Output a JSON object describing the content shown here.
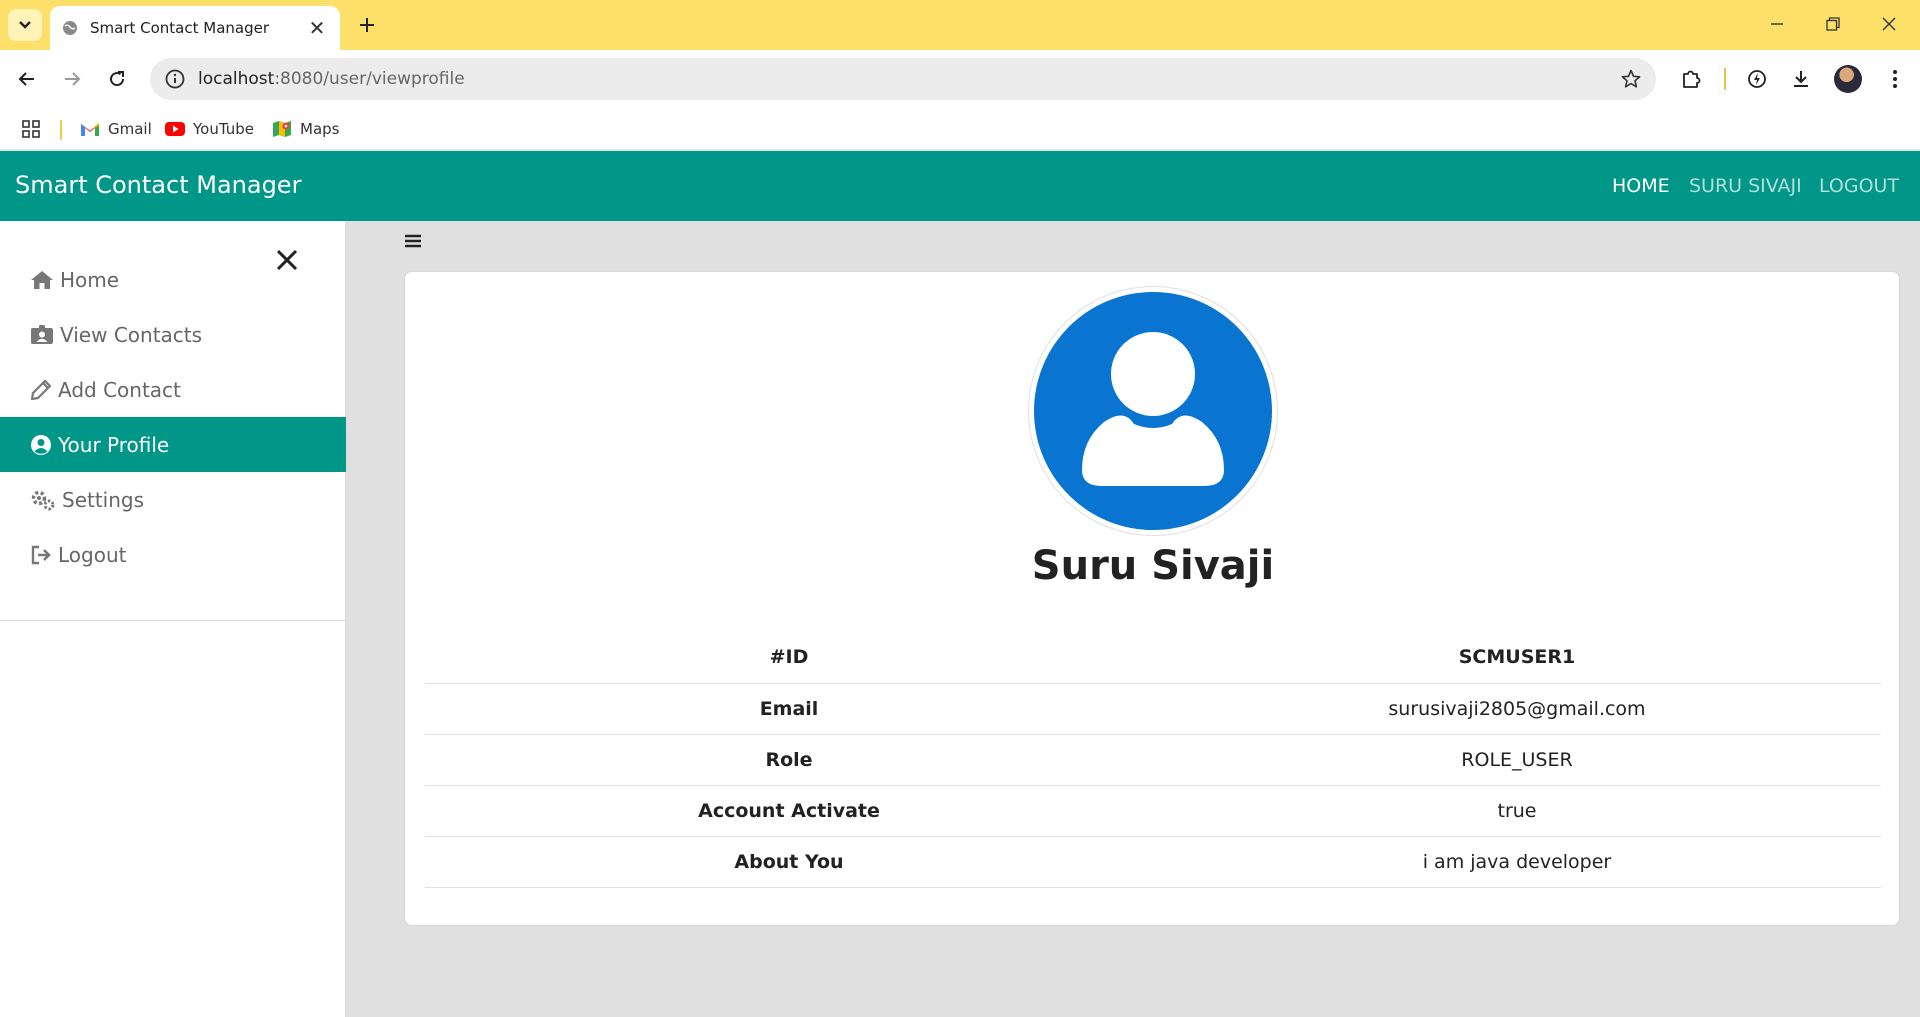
{
  "browser": {
    "tab_title": "Smart Contact Manager",
    "url_host": "localhost",
    "url_path": ":8080/user/viewprofile",
    "bookmarks": [
      {
        "label": "Gmail",
        "icon": "gmail-icon"
      },
      {
        "label": "YouTube",
        "icon": "youtube-icon"
      },
      {
        "label": "Maps",
        "icon": "maps-icon"
      }
    ]
  },
  "navbar": {
    "brand": "Smart Contact Manager",
    "links": [
      "HOME",
      "SURU SIVAJI",
      "LOGOUT"
    ],
    "color": "#009688"
  },
  "sidebar": {
    "items": [
      {
        "label": "Home",
        "icon": "home-icon"
      },
      {
        "label": "View Contacts",
        "icon": "contacts-icon"
      },
      {
        "label": "Add Contact",
        "icon": "pencil-icon"
      },
      {
        "label": "Your Profile",
        "icon": "user-circle-icon",
        "active": true
      },
      {
        "label": "Settings",
        "icon": "gears-icon"
      },
      {
        "label": "Logout",
        "icon": "sign-out-icon"
      }
    ]
  },
  "profile": {
    "name": "Suru Sivaji",
    "avatar_color": "#0a74d1",
    "rows": [
      {
        "key": "#ID",
        "value": "SCMUSER1"
      },
      {
        "key": "Email",
        "value": "surusivaji2805@gmail.com"
      },
      {
        "key": "Role",
        "value": "ROLE_USER"
      },
      {
        "key": "Account Activate",
        "value": "true"
      },
      {
        "key": "About You",
        "value": "i am java developer"
      }
    ]
  }
}
